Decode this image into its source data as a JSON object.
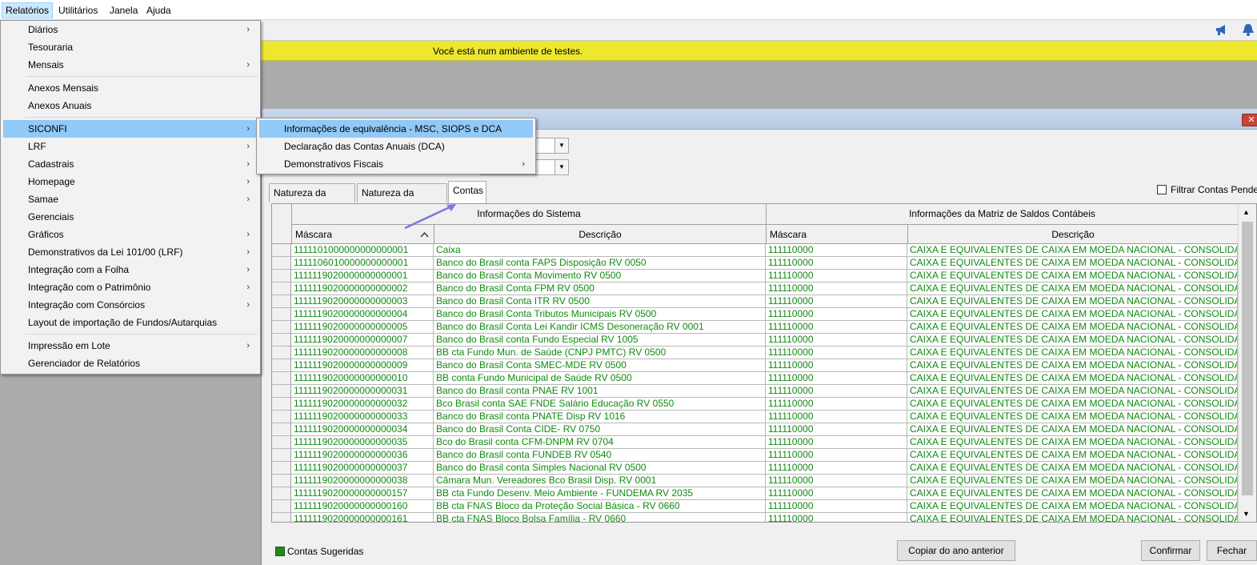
{
  "menubar": {
    "items": [
      "Relatórios",
      "Utilitários",
      "Janela",
      "Ajuda"
    ]
  },
  "testbar": {
    "message": "Você está num ambiente de testes."
  },
  "menu": {
    "items": [
      {
        "label": "Diários",
        "submenu": true
      },
      {
        "label": "Tesouraria",
        "submenu": false
      },
      {
        "label": "Mensais",
        "submenu": true
      },
      {
        "label": "Anexos Mensais",
        "submenu": false
      },
      {
        "label": "Anexos Anuais",
        "submenu": false
      },
      {
        "label": "SICONFI",
        "submenu": true
      },
      {
        "label": "LRF",
        "submenu": true
      },
      {
        "label": "Cadastrais",
        "submenu": true
      },
      {
        "label": "Homepage",
        "submenu": true
      },
      {
        "label": "Samae",
        "submenu": true
      },
      {
        "label": "Gerenciais",
        "submenu": false
      },
      {
        "label": "Gráficos",
        "submenu": true
      },
      {
        "label": "Demonstrativos da Lei 101/00 (LRF)",
        "submenu": true
      },
      {
        "label": "Integração com a Folha",
        "submenu": true
      },
      {
        "label": "Integração com o Patrimônio",
        "submenu": true
      },
      {
        "label": "Integração com Consórcios",
        "submenu": true
      },
      {
        "label": "Layout de importação de Fundos/Autarquias",
        "submenu": false
      },
      {
        "label": "Impressão em Lote",
        "submenu": true
      },
      {
        "label": "Gerenciador de Relatórios",
        "submenu": false
      }
    ],
    "arrow_glyph": "›"
  },
  "submenu": {
    "items": [
      {
        "label": "Informações de equivalência - MSC, SIOPS e DCA",
        "submenu": false
      },
      {
        "label": "Declaração das Contas Anuais (DCA)",
        "submenu": false
      },
      {
        "label": "Demonstrativos Fiscais",
        "submenu": true
      }
    ]
  },
  "tabs": [
    "Natureza da Receita",
    "Natureza da Despesa",
    "Contas"
  ],
  "filter": {
    "label": "Filtrar Contas Pendentes"
  },
  "grid": {
    "group_headers": [
      "Informações do Sistema",
      "Informações da Matriz de Saldos Contábeis"
    ],
    "columns": [
      "Máscara",
      "Descrição",
      "Máscara",
      "Descrição"
    ],
    "rows": [
      [
        "1111101000000000000001",
        "Caixa",
        "111110000",
        "CAIXA E EQUIVALENTES DE CAIXA EM MOEDA NACIONAL - CONSOLIDAÇÃO"
      ],
      [
        "1111106010000000000001",
        "Banco do Brasil conta FAPS Disposição RV 0050",
        "111110000",
        "CAIXA E EQUIVALENTES DE CAIXA EM MOEDA NACIONAL - CONSOLIDAÇÃO"
      ],
      [
        "1111119020000000000001",
        "Banco do Brasil Conta Movimento RV 0500",
        "111110000",
        "CAIXA E EQUIVALENTES DE CAIXA EM MOEDA NACIONAL - CONSOLIDAÇÃO"
      ],
      [
        "1111119020000000000002",
        "Banco do Brasil Conta FPM RV 0500",
        "111110000",
        "CAIXA E EQUIVALENTES DE CAIXA EM MOEDA NACIONAL - CONSOLIDAÇÃO"
      ],
      [
        "1111119020000000000003",
        "Banco do Brasil Conta ITR RV 0500",
        "111110000",
        "CAIXA E EQUIVALENTES DE CAIXA EM MOEDA NACIONAL - CONSOLIDAÇÃO"
      ],
      [
        "1111119020000000000004",
        "Banco do Brasil Conta Tributos Municipais RV 0500",
        "111110000",
        "CAIXA E EQUIVALENTES DE CAIXA EM MOEDA NACIONAL - CONSOLIDAÇÃO"
      ],
      [
        "1111119020000000000005",
        "Banco do Brasil Conta Lei Kandir ICMS Desoneração RV 0001",
        "111110000",
        "CAIXA E EQUIVALENTES DE CAIXA EM MOEDA NACIONAL - CONSOLIDAÇÃO"
      ],
      [
        "1111119020000000000007",
        "Banco do Brasil conta Fundo Especial RV 1005",
        "111110000",
        "CAIXA E EQUIVALENTES DE CAIXA EM MOEDA NACIONAL - CONSOLIDAÇÃO"
      ],
      [
        "1111119020000000000008",
        "BB cta Fundo Mun. de Saúde (CNPJ PMTC) RV 0500",
        "111110000",
        "CAIXA E EQUIVALENTES DE CAIXA EM MOEDA NACIONAL - CONSOLIDAÇÃO"
      ],
      [
        "1111119020000000000009",
        "Banco do Brasil Conta SMEC-MDE RV 0500",
        "111110000",
        "CAIXA E EQUIVALENTES DE CAIXA EM MOEDA NACIONAL - CONSOLIDAÇÃO"
      ],
      [
        "1111119020000000000010",
        "BB conta Fundo Municipal de Saúde RV 0500",
        "111110000",
        "CAIXA E EQUIVALENTES DE CAIXA EM MOEDA NACIONAL - CONSOLIDAÇÃO"
      ],
      [
        "1111119020000000000031",
        "Banco do Brasil conta PNAE RV 1001",
        "111110000",
        "CAIXA E EQUIVALENTES DE CAIXA EM MOEDA NACIONAL - CONSOLIDAÇÃO"
      ],
      [
        "1111119020000000000032",
        "Bco Brasil conta SAE FNDE Salário Educação RV 0550",
        "111110000",
        "CAIXA E EQUIVALENTES DE CAIXA EM MOEDA NACIONAL - CONSOLIDAÇÃO"
      ],
      [
        "1111119020000000000033",
        "Banco do Brasil conta PNATE Disp RV 1016",
        "111110000",
        "CAIXA E EQUIVALENTES DE CAIXA EM MOEDA NACIONAL - CONSOLIDAÇÃO"
      ],
      [
        "1111119020000000000034",
        "Banco do Brasil Conta CIDE- RV 0750",
        "111110000",
        "CAIXA E EQUIVALENTES DE CAIXA EM MOEDA NACIONAL - CONSOLIDAÇÃO"
      ],
      [
        "1111119020000000000035",
        "Bco do Brasil conta CFM-DNPM RV 0704",
        "111110000",
        "CAIXA E EQUIVALENTES DE CAIXA EM MOEDA NACIONAL - CONSOLIDAÇÃO"
      ],
      [
        "1111119020000000000036",
        "Banco do Brasil conta FUNDEB RV 0540",
        "111110000",
        "CAIXA E EQUIVALENTES DE CAIXA EM MOEDA NACIONAL - CONSOLIDAÇÃO"
      ],
      [
        "1111119020000000000037",
        "Banco do Brasil conta Simples Nacional RV 0500",
        "111110000",
        "CAIXA E EQUIVALENTES DE CAIXA EM MOEDA NACIONAL - CONSOLIDAÇÃO"
      ],
      [
        "1111119020000000000038",
        "Câmara Mun. Vereadores Bco Brasil Disp. RV 0001",
        "111110000",
        "CAIXA E EQUIVALENTES DE CAIXA EM MOEDA NACIONAL - CONSOLIDAÇÃO"
      ],
      [
        "1111119020000000000157",
        "BB cta Fundo Desenv. Meio Ambiente - FUNDEMA RV 2035",
        "111110000",
        "CAIXA E EQUIVALENTES DE CAIXA EM MOEDA NACIONAL - CONSOLIDAÇÃO"
      ],
      [
        "1111119020000000000160",
        "BB cta FNAS Bloco da Proteção Social Básica - RV 0660",
        "111110000",
        "CAIXA E EQUIVALENTES DE CAIXA EM MOEDA NACIONAL - CONSOLIDAÇÃO"
      ],
      [
        "1111119020000000000161",
        "BB cta FNAS Bloco Bolsa Família - RV 0660",
        "111110000",
        "CAIXA E EQUIVALENTES DE CAIXA EM MOEDA NACIONAL - CONSOLIDAÇÃO"
      ]
    ]
  },
  "legend": {
    "label": "Contas Sugeridas",
    "color": "#1e8a1e"
  },
  "buttons": {
    "copy": "Copiar do ano anterior",
    "confirm": "Confirmar",
    "close": "Fechar"
  },
  "colors": {
    "test_banner": "#ede82f",
    "menu_highlight": "#91c9f7",
    "row_text": "#118a11"
  },
  "icons": {
    "speaker": "megaphone-icon",
    "bell": "bell-icon",
    "window_close": "close-icon",
    "sort": "sort-arrow-icon"
  }
}
